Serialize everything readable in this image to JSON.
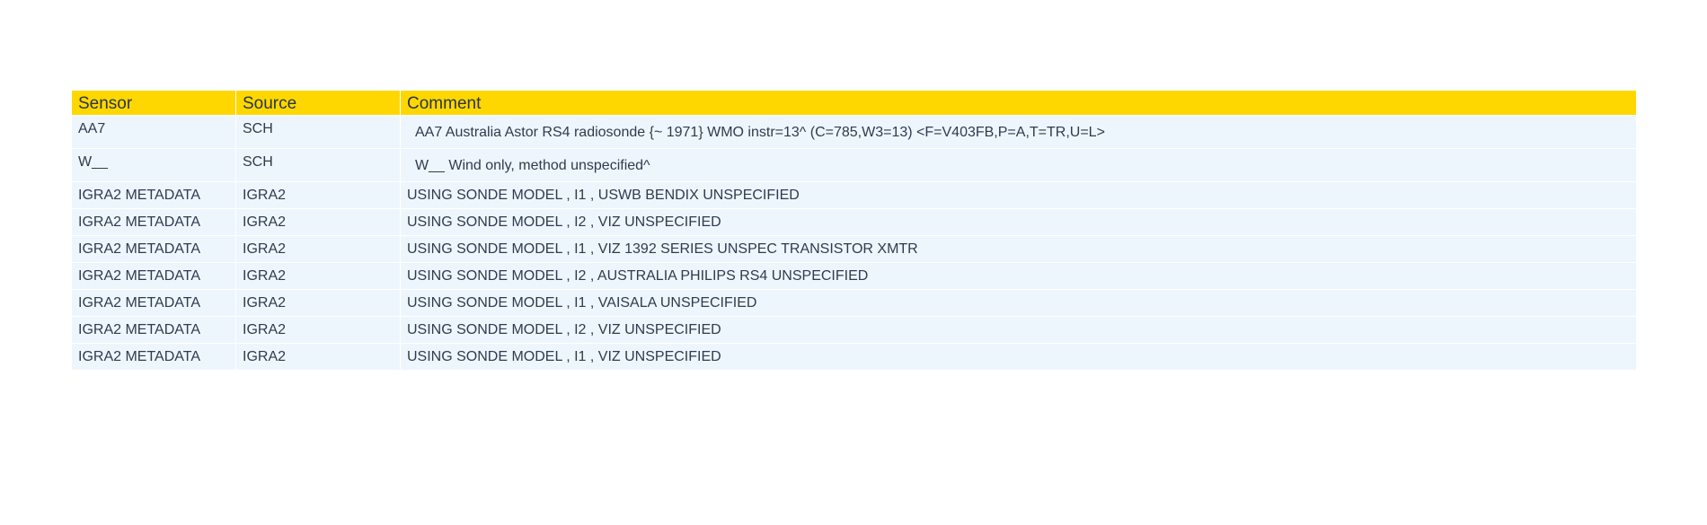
{
  "table": {
    "headers": {
      "sensor": "Sensor",
      "source": "Source",
      "comment": "Comment"
    },
    "rows": [
      {
        "sensor": "AA7",
        "source": "SCH",
        "comment": "AA7 Australia Astor RS4 radiosonde {~ 1971} WMO instr=13^ (C=785,W3=13) <F=V403FB,P=A,T=TR,U=L>"
      },
      {
        "sensor": "W__",
        "source": "SCH",
        "comment": "W__ Wind only, method unspecified^"
      },
      {
        "sensor": "IGRA2 METADATA",
        "source": "IGRA2",
        "comment": "USING SONDE MODEL , I1 , USWB BENDIX UNSPECIFIED"
      },
      {
        "sensor": "IGRA2 METADATA",
        "source": "IGRA2",
        "comment": "USING SONDE MODEL , I2 , VIZ UNSPECIFIED"
      },
      {
        "sensor": "IGRA2 METADATA",
        "source": "IGRA2",
        "comment": "USING SONDE MODEL , I1 , VIZ 1392 SERIES UNSPEC TRANSISTOR XMTR"
      },
      {
        "sensor": "IGRA2 METADATA",
        "source": "IGRA2",
        "comment": "USING SONDE MODEL , I2 , AUSTRALIA PHILIPS RS4 UNSPECIFIED"
      },
      {
        "sensor": "IGRA2 METADATA",
        "source": "IGRA2",
        "comment": "USING SONDE MODEL , I1 , VAISALA UNSPECIFIED"
      },
      {
        "sensor": "IGRA2 METADATA",
        "source": "IGRA2",
        "comment": "USING SONDE MODEL , I2 , VIZ UNSPECIFIED"
      },
      {
        "sensor": "IGRA2 METADATA",
        "source": "IGRA2",
        "comment": "USING SONDE MODEL , I1 , VIZ UNSPECIFIED"
      }
    ]
  }
}
